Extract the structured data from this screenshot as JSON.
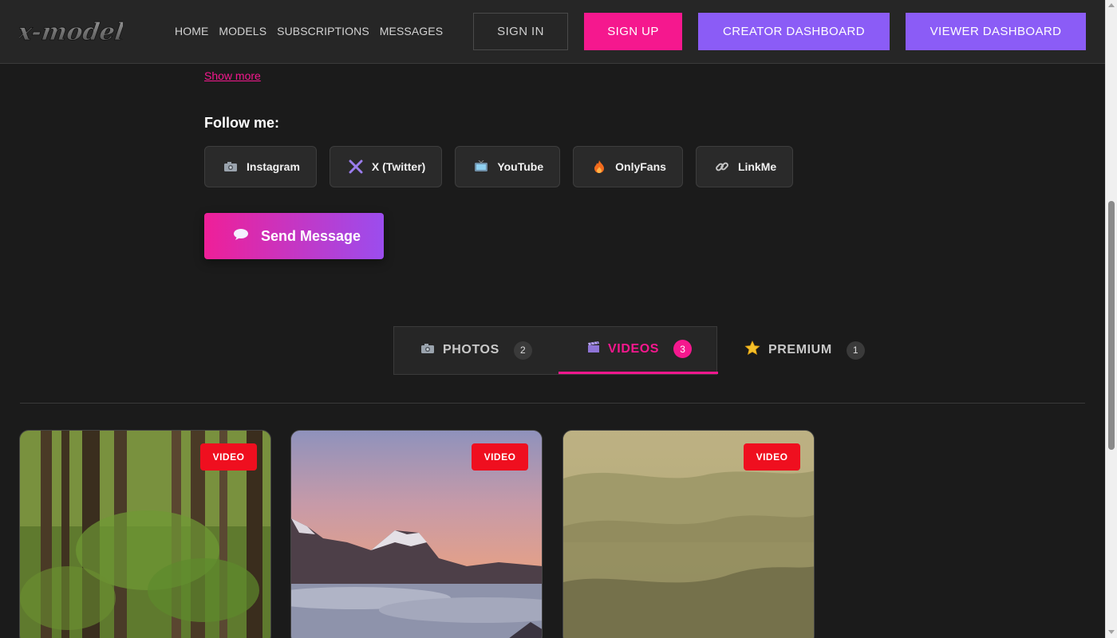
{
  "brand": {
    "logo_text": "x-models"
  },
  "nav": {
    "items": [
      "HOME",
      "MODELS",
      "SUBSCRIPTIONS",
      "MESSAGES"
    ]
  },
  "auth": {
    "signin": "SIGN IN",
    "signup": "SIGN UP",
    "creator_dashboard": "CREATOR DASHBOARD",
    "viewer_dashboard": "VIEWER DASHBOARD"
  },
  "bio": {
    "show_more": "Show more",
    "follow_title": "Follow me:"
  },
  "socials": [
    {
      "label": "Instagram",
      "icon": "camera-icon"
    },
    {
      "label": "X (Twitter)",
      "icon": "x-icon"
    },
    {
      "label": "YouTube",
      "icon": "tv-icon"
    },
    {
      "label": "OnlyFans",
      "icon": "fire-icon"
    },
    {
      "label": "LinkMe",
      "icon": "link-icon"
    }
  ],
  "send_message": {
    "label": "Send Message",
    "icon": "speech-bubble-icon"
  },
  "tabs": [
    {
      "label": "PHOTOS",
      "count": "2",
      "icon": "camera-icon",
      "active": false
    },
    {
      "label": "VIDEOS",
      "count": "3",
      "icon": "clapperboard-icon",
      "active": true
    },
    {
      "label": "PREMIUM",
      "count": "1",
      "icon": "star-icon",
      "active": false
    }
  ],
  "cards": [
    {
      "badge": "VIDEO",
      "scene": "forest"
    },
    {
      "badge": "VIDEO",
      "scene": "mountains-sea-of-clouds"
    },
    {
      "badge": "VIDEO",
      "scene": "misty-hills"
    }
  ],
  "colors": {
    "accent_pink": "#f5188e",
    "accent_purple": "#8b5cf6",
    "badge_red": "#ef0f1f",
    "background": "#1b1b1b"
  }
}
